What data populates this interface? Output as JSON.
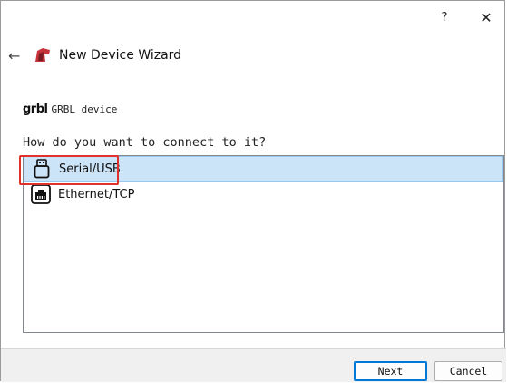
{
  "titlebar": {
    "help_label": "?",
    "close_label": "✕"
  },
  "header": {
    "back_label": "←",
    "title": "New Device Wizard"
  },
  "device": {
    "logo_text": "grbl",
    "name": "GRBL device"
  },
  "question": "How do you want to connect to it?",
  "options": [
    {
      "label": "Serial/USB",
      "icon": "usb-icon",
      "selected": true
    },
    {
      "label": "Ethernet/TCP",
      "icon": "ethernet-icon",
      "selected": false
    }
  ],
  "buttons": {
    "next": "Next",
    "cancel": "Cancel"
  },
  "colors": {
    "selection": "#cce4f7",
    "highlight_box": "#e0322b",
    "logo": "#c7333b"
  }
}
